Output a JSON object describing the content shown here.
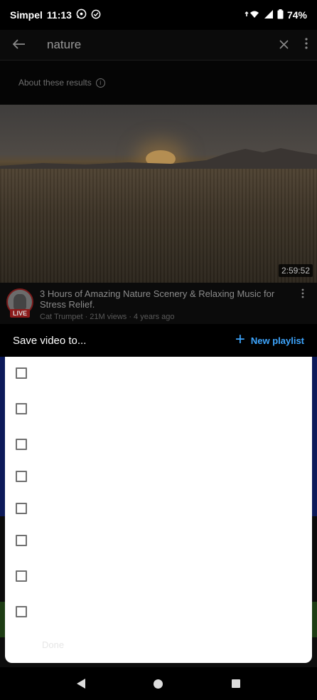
{
  "status_bar": {
    "carrier": "Simpel",
    "time": "11:13",
    "battery": "74%"
  },
  "search": {
    "query": "nature"
  },
  "about": {
    "label": "About these results"
  },
  "video": {
    "duration": "2:59:52",
    "title": "3 Hours of Amazing Nature Scenery & Relaxing Music for Stress Relief.",
    "live_badge": "LIVE",
    "subtitle": "Cat Trumpet · 21M views · 4 years ago"
  },
  "sheet": {
    "title": "Save video to...",
    "new_playlist_label": "New playlist",
    "done_label": "Done",
    "checkbox_count": 8
  },
  "colors": {
    "accent": "#3ea6ff",
    "background": "#000000",
    "sheet": "#ffffff"
  }
}
